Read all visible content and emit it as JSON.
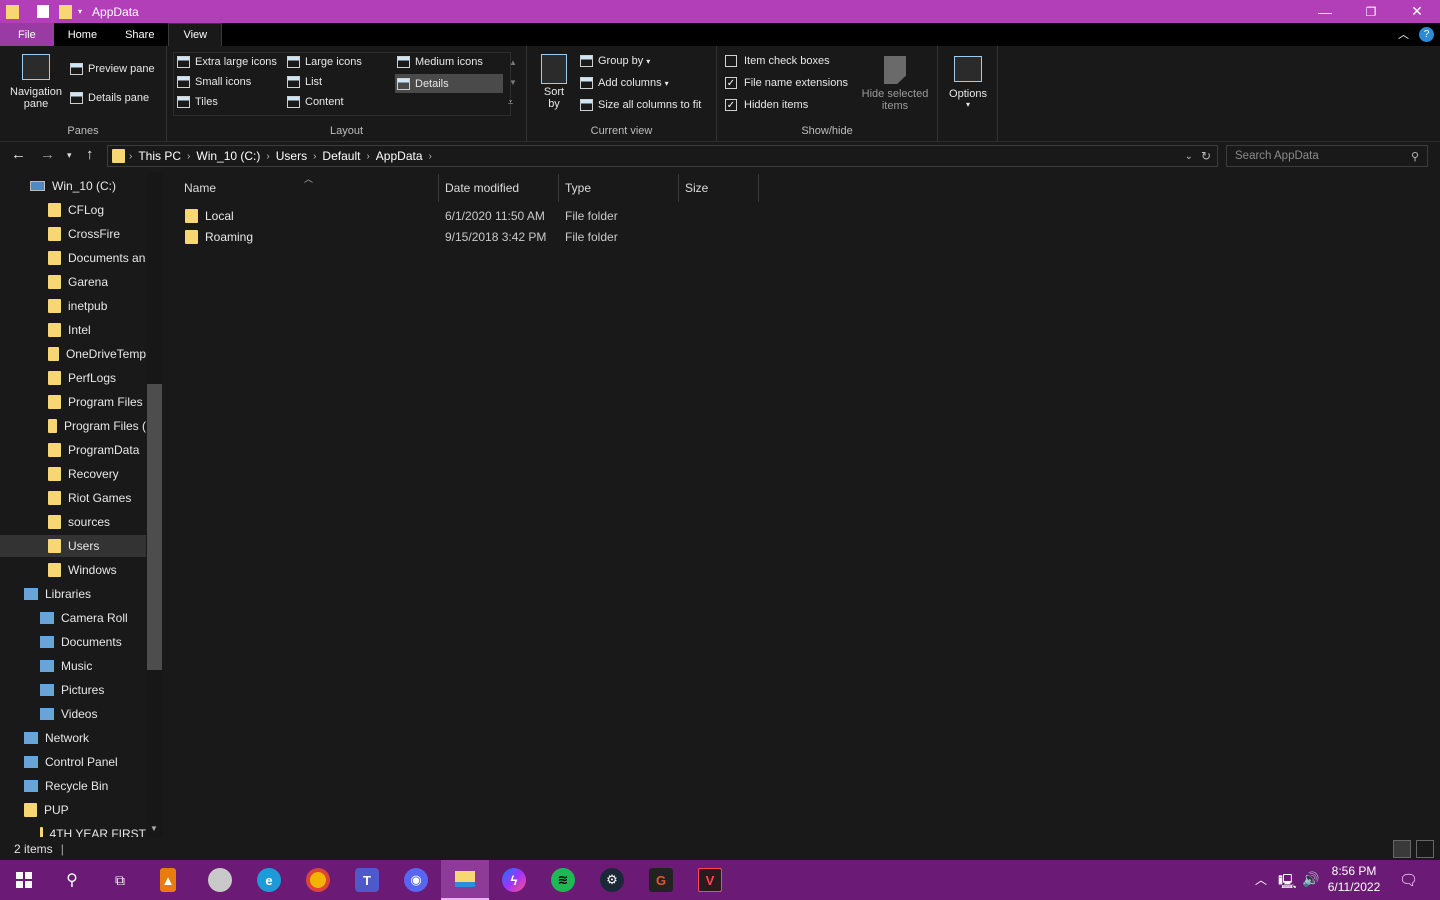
{
  "window": {
    "title": "AppData"
  },
  "ribbon_tabs": [
    "File",
    "Home",
    "Share",
    "View"
  ],
  "ribbon": {
    "panes": {
      "navigation_pane": "Navigation pane",
      "preview_pane": "Preview pane",
      "details_pane": "Details pane",
      "label": "Panes"
    },
    "layout": {
      "items": [
        "Extra large icons",
        "Large icons",
        "Medium icons",
        "Small icons",
        "List",
        "Details",
        "Tiles",
        "Content"
      ],
      "selected": "Details",
      "label": "Layout"
    },
    "current_view": {
      "sort_by": "Sort by",
      "group_by": "Group by",
      "add_columns": "Add columns",
      "size_all_columns": "Size all columns to fit",
      "label": "Current view"
    },
    "show_hide": {
      "item_check_boxes": {
        "label": "Item check boxes",
        "checked": false
      },
      "file_name_extensions": {
        "label": "File name extensions",
        "checked": true
      },
      "hidden_items": {
        "label": "Hidden items",
        "checked": true
      },
      "hide_selected": "Hide selected items",
      "label": "Show/hide"
    },
    "options": "Options"
  },
  "breadcrumb": [
    "This PC",
    "Win_10 (C:)",
    "Users",
    "Default",
    "AppData"
  ],
  "search": {
    "placeholder": "Search AppData"
  },
  "nav_tree": [
    {
      "label": "Win_10 (C:)",
      "icon": "drive-icon"
    },
    {
      "label": "CFLog",
      "icon": "folder-icon"
    },
    {
      "label": "CrossFire",
      "icon": "folder-icon"
    },
    {
      "label": "Documents an",
      "icon": "folder-icon"
    },
    {
      "label": "Garena",
      "icon": "folder-icon"
    },
    {
      "label": "inetpub",
      "icon": "folder-icon"
    },
    {
      "label": "Intel",
      "icon": "folder-icon"
    },
    {
      "label": "OneDriveTemp",
      "icon": "folder-icon"
    },
    {
      "label": "PerfLogs",
      "icon": "folder-icon"
    },
    {
      "label": "Program Files",
      "icon": "folder-icon"
    },
    {
      "label": "Program Files (",
      "icon": "folder-icon"
    },
    {
      "label": "ProgramData",
      "icon": "folder-icon"
    },
    {
      "label": "Recovery",
      "icon": "folder-icon"
    },
    {
      "label": "Riot Games",
      "icon": "folder-icon"
    },
    {
      "label": "sources",
      "icon": "folder-icon"
    },
    {
      "label": "Users",
      "icon": "folder-icon",
      "selected": true
    },
    {
      "label": "Windows",
      "icon": "folder-icon"
    },
    {
      "label": "Libraries",
      "icon": "library-icon"
    },
    {
      "label": "Camera Roll",
      "icon": "library-icon"
    },
    {
      "label": "Documents",
      "icon": "library-icon"
    },
    {
      "label": "Music",
      "icon": "music-icon"
    },
    {
      "label": "Pictures",
      "icon": "library-icon"
    },
    {
      "label": "Videos",
      "icon": "library-icon"
    },
    {
      "label": "Network",
      "icon": "network-icon"
    },
    {
      "label": "Control Panel",
      "icon": "control-panel-icon"
    },
    {
      "label": "Recycle Bin",
      "icon": "recycle-bin-icon"
    },
    {
      "label": "PUP",
      "icon": "folder-icon"
    },
    {
      "label": "4TH YEAR FIRST",
      "icon": "folder-icon"
    }
  ],
  "columns": [
    "Name",
    "Date modified",
    "Type",
    "Size"
  ],
  "files": [
    {
      "name": "Local",
      "date": "6/1/2020 11:50 AM",
      "type": "File folder",
      "size": ""
    },
    {
      "name": "Roaming",
      "date": "9/15/2018 3:42 PM",
      "type": "File folder",
      "size": ""
    }
  ],
  "status": {
    "items": "2 items"
  },
  "taskbar": {
    "apps": [
      "start",
      "search",
      "task-view",
      "vlc",
      "app",
      "edge",
      "chrome",
      "teams",
      "discord",
      "file-explorer",
      "messenger",
      "spotify",
      "steam",
      "garena",
      "valorant"
    ],
    "time": "8:56 PM",
    "date": "6/11/2022"
  },
  "colors": {
    "titlebar": "#b23fb8",
    "taskbar": "#6b1a75",
    "background": "#191919",
    "folder": "#f7d774"
  }
}
